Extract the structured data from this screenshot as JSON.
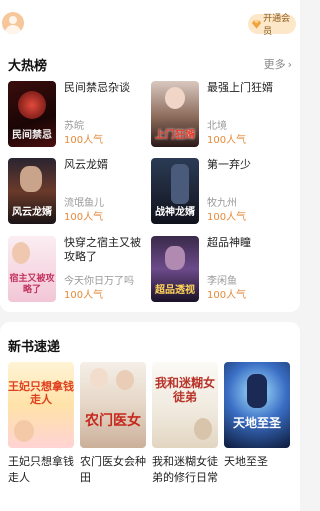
{
  "header": {
    "vip_label": "开通会员",
    "avatar_icon": "user-avatar-icon",
    "vip_icon": "diamond-icon"
  },
  "hot": {
    "title": "大热榜",
    "more_label": "更多",
    "books": [
      {
        "title": "民间禁忌杂谈",
        "author": "苏皖",
        "popularity": "100人气",
        "cover_text": "民间禁忌"
      },
      {
        "title": "最强上门狂婿",
        "author": "北境",
        "popularity": "100人气",
        "cover_text": "上门狂婿"
      },
      {
        "title": "风云龙婿",
        "author": "流氓鱼儿",
        "popularity": "100人气",
        "cover_text": "风云龙婿"
      },
      {
        "title": "第一弃少",
        "author": "牧九州",
        "popularity": "100人气",
        "cover_text": "战神龙婿"
      },
      {
        "title": "快穿之宿主又被攻略了",
        "author": "今天你日万了吗",
        "popularity": "100人气",
        "cover_text": "宿主又被攻略了"
      },
      {
        "title": "超品神瞳",
        "author": "李闲鱼",
        "popularity": "100人气",
        "cover_text": "超品透视"
      }
    ]
  },
  "newbooks": {
    "title": "新书速递",
    "books": [
      {
        "title": "王妃只想拿钱走人",
        "cover_text": "王妃只想拿钱走人"
      },
      {
        "title": "农门医女会种田",
        "cover_text": "农门医女"
      },
      {
        "title": "我和迷糊女徒弟的修行日常",
        "cover_text": "我和迷糊女徒弟"
      },
      {
        "title": "天地至圣",
        "cover_text": "天地至圣"
      }
    ]
  }
}
